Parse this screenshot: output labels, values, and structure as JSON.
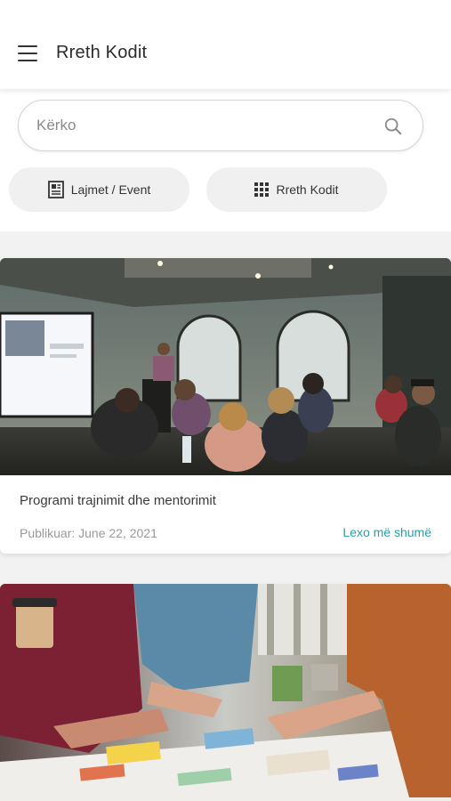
{
  "header": {
    "title": "Rreth Kodit",
    "menu_icon": "hamburger-menu-icon"
  },
  "search": {
    "placeholder": "Kërko",
    "value": "",
    "icon": "search-icon"
  },
  "nav_pills": [
    {
      "label": "Lajmet / Event",
      "icon": "newspaper-icon"
    },
    {
      "label": "Rreth Kodit",
      "icon": "grid-icon"
    }
  ],
  "cards": [
    {
      "image": "presentation-room-photo",
      "title": "Programi trajnimit dhe mentorimit",
      "date": "Publikuar: June 22, 2021",
      "link": "Lexo më shumë"
    },
    {
      "image": "team-workshop-photo"
    }
  ],
  "colors": {
    "accent": "#2a9fa8",
    "background": "#f2f2f2",
    "pill": "#f0f0f0"
  }
}
